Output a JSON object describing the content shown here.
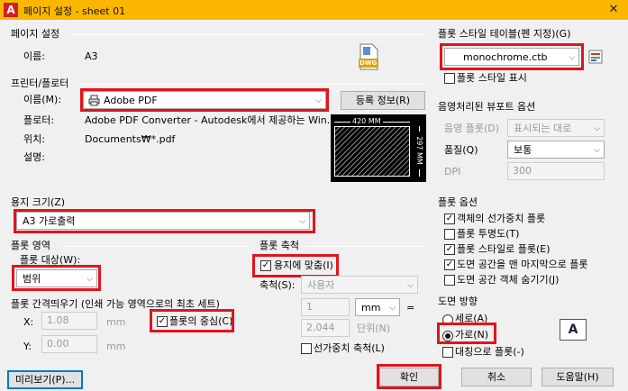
{
  "window": {
    "title": "페이지 설정 - sheet 01",
    "close_glyph": "✕",
    "app_letter": "A"
  },
  "page_setup": {
    "section": "페이지 설정",
    "name_label": "이름:",
    "name_value": "A3",
    "dwg_badge": "DWG"
  },
  "printer": {
    "section": "프린터/플로터",
    "name_label": "이름(M):",
    "selected": "Adobe PDF",
    "properties_button": "등록 정보(R)",
    "plotter_label": "플로터:",
    "plotter_value": "Adobe PDF Converter - Autodesk에서 제공하는 Win...",
    "location_label": "위치:",
    "location_value": "Documents₩*.pdf",
    "description_label": "설명:",
    "preview_width": "420 MM",
    "preview_height": "297 MM"
  },
  "paper_size": {
    "section": "용지 크기(Z)",
    "selected": "A3 가로출력"
  },
  "plot_area": {
    "section": "플롯 영역",
    "what_label": "플롯 대상(W):",
    "selected": "범위"
  },
  "plot_offset": {
    "section": "플롯 간격띄우기 (인쇄 가능 영역으로의 최초 세트)",
    "x_label": "X:",
    "x_value": "1.08",
    "x_unit": "mm",
    "y_label": "Y:",
    "y_value": "0.00",
    "y_unit": "mm",
    "center_label": "플롯의 중심(C)",
    "center_checked": true
  },
  "plot_scale": {
    "section": "플롯 축척",
    "fit_label": "용지에 맞춤(I)",
    "fit_checked": true,
    "scale_label": "축척(S):",
    "scale_value": "사용자",
    "value1": "1",
    "unit_selected": "mm",
    "equals": "=",
    "value2": "2.044",
    "unit2_label": "단위(N)",
    "lineweights_label": "선가중치 축척(L)",
    "lineweights_checked": false
  },
  "plot_style_table": {
    "section": "플롯 스타일 테이블(펜 지정)(G)",
    "selected": "monochrome.ctb",
    "display_label": "플롯 스타일 표시",
    "display_checked": false
  },
  "shaded_viewport": {
    "section": "음영처리된 뷰포트 옵션",
    "shade_label": "음영 플롯(D)",
    "shade_value": "표시되는 대로",
    "quality_label": "품질(Q)",
    "quality_value": "보통",
    "dpi_label": "DPI",
    "dpi_value": "300"
  },
  "plot_options": {
    "section": "플롯 옵션",
    "items": [
      {
        "label": "객체의 선가중치 플롯",
        "checked": true
      },
      {
        "label": "플롯 투명도(T)",
        "checked": false
      },
      {
        "label": "플롯 스타일로 플롯(E)",
        "checked": true
      },
      {
        "label": "도면 공간을 맨 마지막으로 플롯",
        "checked": true
      },
      {
        "label": "도면 공간 객체 숨기기(J)",
        "checked": false
      }
    ]
  },
  "drawing_orientation": {
    "section": "도면 방향",
    "portrait_label": "세로(A)",
    "landscape_label": "가로(N)",
    "upside_down_label": "대칭으로 플롯(-)",
    "selected": "landscape",
    "icon_letter": "A"
  },
  "buttons": {
    "preview": "미리보기(P)...",
    "ok": "확인",
    "cancel": "취소",
    "help": "도움말(H)"
  },
  "glyphs": {
    "check": "✓",
    "arrow_down": "⌵"
  }
}
